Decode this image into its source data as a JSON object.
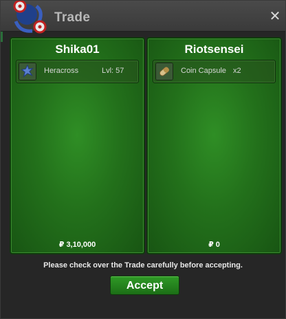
{
  "window": {
    "title": "Trade",
    "close_label": "✕"
  },
  "left_panel": {
    "player": "Shika01",
    "item": {
      "name": "Heracross",
      "level": "Lvl: 57",
      "icon": "heracross-icon"
    },
    "money": "₽ 3,10,000"
  },
  "right_panel": {
    "player": "Riotsensei",
    "item": {
      "name": "Coin Capsule",
      "quantity": "x2",
      "icon": "coin-capsule-icon"
    },
    "money": "₽ 0"
  },
  "notice": "Please check over the Trade carefully before accepting.",
  "accept_label": "Accept",
  "colors": {
    "panel_green": "#23711b",
    "button_green": "#2f9a26",
    "titlebar": "#4a4a4a"
  }
}
